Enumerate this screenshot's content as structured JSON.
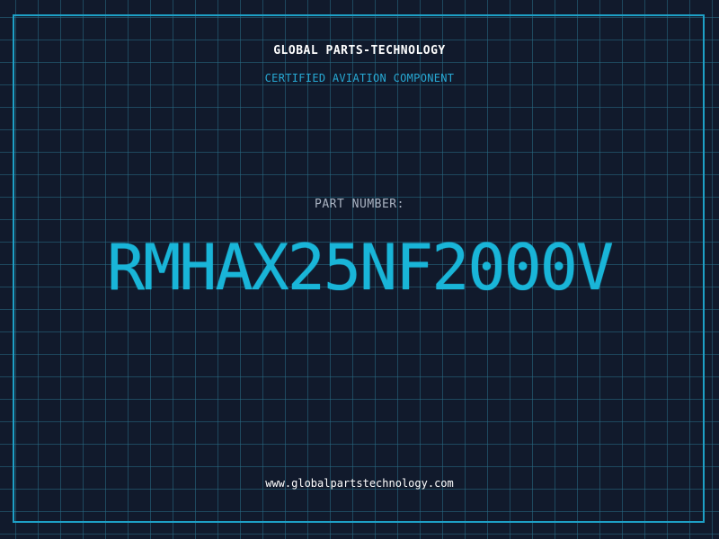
{
  "company": "GLOBAL PARTS-TECHNOLOGY",
  "subtitle": "CERTIFIED AVIATION COMPONENT",
  "part_label": "PART NUMBER:",
  "part_number": "RMHAX25NF2000V",
  "website": "www.globalpartstechnology.com",
  "colors": {
    "background": "#111a2c",
    "grid": "#286e87",
    "accent": "#1ea0c6",
    "part_number": "#19b5d8"
  }
}
